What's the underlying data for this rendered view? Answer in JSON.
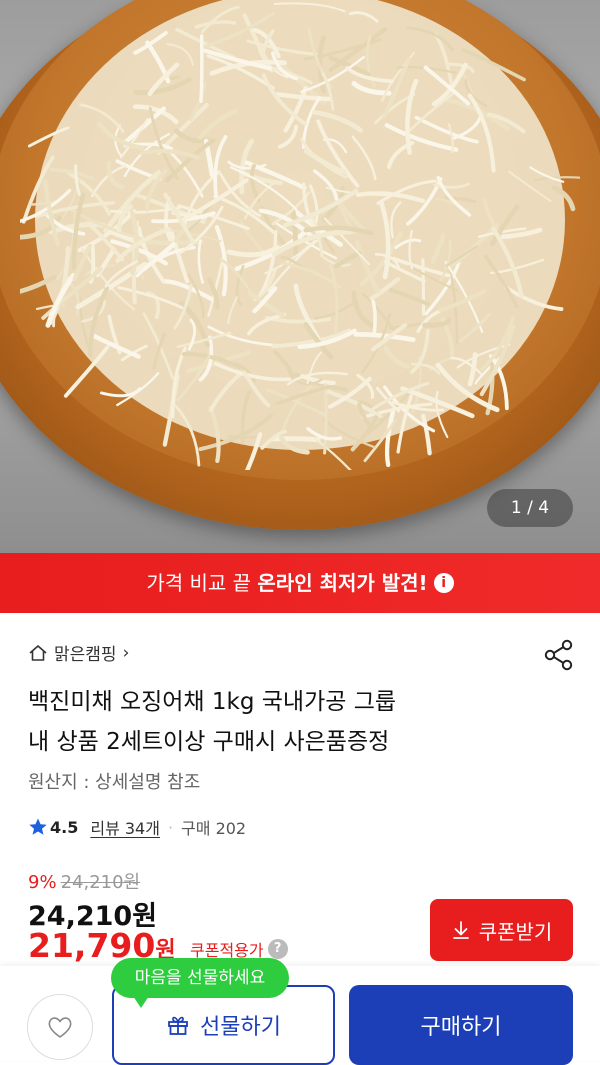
{
  "gallery": {
    "pager": "1 / 4"
  },
  "banner": {
    "text_prefix": "가격 비교 끝 ",
    "text_bold": "온라인 최저가 발견!",
    "info_icon": "i"
  },
  "store": {
    "name": "맑은캠핑",
    "chevron": "›"
  },
  "product": {
    "title_line1": "백진미채 오징어채 1kg 국내가공 그룹",
    "title_line2": "내 상품 2세트이상 구매시 사은품증정",
    "origin": "원산지 : 상세설명 참조",
    "rating": "4.5",
    "reviews": "리뷰 34개",
    "separator": "·",
    "purchases": "구매 202"
  },
  "price": {
    "discount_pct": "9%",
    "original": "24,210원",
    "sale": "24,210원",
    "coupon_price_number": "21,790",
    "coupon_price_unit": "원",
    "coupon_applied": "쿠폰적용가",
    "help_icon": "?"
  },
  "actions": {
    "coupon_button": "쿠폰받기",
    "gift_tooltip": "마음을 선물하세요",
    "gift_button": "선물하기",
    "buy_button": "구매하기"
  },
  "colors": {
    "accent_red": "#e81d1d",
    "brand_blue": "#1c3fb8",
    "tooltip_green": "#2ecc3f"
  }
}
